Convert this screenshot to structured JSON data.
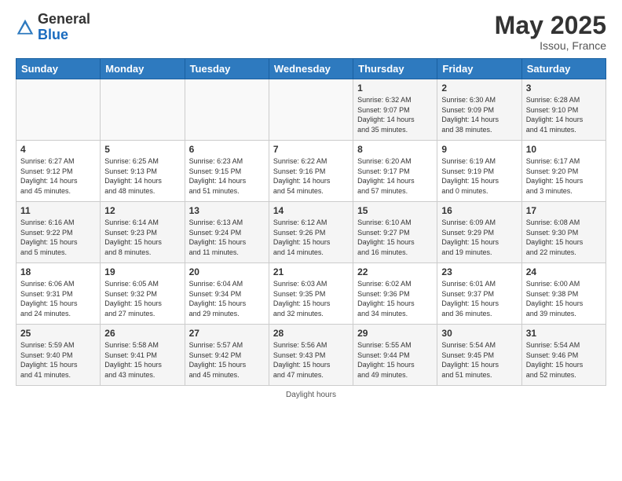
{
  "header": {
    "logo_general": "General",
    "logo_blue": "Blue",
    "month_title": "May 2025",
    "location": "Issou, France"
  },
  "footer": {
    "daylight_label": "Daylight hours"
  },
  "days_of_week": [
    "Sunday",
    "Monday",
    "Tuesday",
    "Wednesday",
    "Thursday",
    "Friday",
    "Saturday"
  ],
  "weeks": [
    {
      "days": [
        {
          "num": "",
          "info": ""
        },
        {
          "num": "",
          "info": ""
        },
        {
          "num": "",
          "info": ""
        },
        {
          "num": "",
          "info": ""
        },
        {
          "num": "1",
          "info": "Sunrise: 6:32 AM\nSunset: 9:07 PM\nDaylight: 14 hours\nand 35 minutes."
        },
        {
          "num": "2",
          "info": "Sunrise: 6:30 AM\nSunset: 9:09 PM\nDaylight: 14 hours\nand 38 minutes."
        },
        {
          "num": "3",
          "info": "Sunrise: 6:28 AM\nSunset: 9:10 PM\nDaylight: 14 hours\nand 41 minutes."
        }
      ]
    },
    {
      "days": [
        {
          "num": "4",
          "info": "Sunrise: 6:27 AM\nSunset: 9:12 PM\nDaylight: 14 hours\nand 45 minutes."
        },
        {
          "num": "5",
          "info": "Sunrise: 6:25 AM\nSunset: 9:13 PM\nDaylight: 14 hours\nand 48 minutes."
        },
        {
          "num": "6",
          "info": "Sunrise: 6:23 AM\nSunset: 9:15 PM\nDaylight: 14 hours\nand 51 minutes."
        },
        {
          "num": "7",
          "info": "Sunrise: 6:22 AM\nSunset: 9:16 PM\nDaylight: 14 hours\nand 54 minutes."
        },
        {
          "num": "8",
          "info": "Sunrise: 6:20 AM\nSunset: 9:17 PM\nDaylight: 14 hours\nand 57 minutes."
        },
        {
          "num": "9",
          "info": "Sunrise: 6:19 AM\nSunset: 9:19 PM\nDaylight: 15 hours\nand 0 minutes."
        },
        {
          "num": "10",
          "info": "Sunrise: 6:17 AM\nSunset: 9:20 PM\nDaylight: 15 hours\nand 3 minutes."
        }
      ]
    },
    {
      "days": [
        {
          "num": "11",
          "info": "Sunrise: 6:16 AM\nSunset: 9:22 PM\nDaylight: 15 hours\nand 5 minutes."
        },
        {
          "num": "12",
          "info": "Sunrise: 6:14 AM\nSunset: 9:23 PM\nDaylight: 15 hours\nand 8 minutes."
        },
        {
          "num": "13",
          "info": "Sunrise: 6:13 AM\nSunset: 9:24 PM\nDaylight: 15 hours\nand 11 minutes."
        },
        {
          "num": "14",
          "info": "Sunrise: 6:12 AM\nSunset: 9:26 PM\nDaylight: 15 hours\nand 14 minutes."
        },
        {
          "num": "15",
          "info": "Sunrise: 6:10 AM\nSunset: 9:27 PM\nDaylight: 15 hours\nand 16 minutes."
        },
        {
          "num": "16",
          "info": "Sunrise: 6:09 AM\nSunset: 9:29 PM\nDaylight: 15 hours\nand 19 minutes."
        },
        {
          "num": "17",
          "info": "Sunrise: 6:08 AM\nSunset: 9:30 PM\nDaylight: 15 hours\nand 22 minutes."
        }
      ]
    },
    {
      "days": [
        {
          "num": "18",
          "info": "Sunrise: 6:06 AM\nSunset: 9:31 PM\nDaylight: 15 hours\nand 24 minutes."
        },
        {
          "num": "19",
          "info": "Sunrise: 6:05 AM\nSunset: 9:32 PM\nDaylight: 15 hours\nand 27 minutes."
        },
        {
          "num": "20",
          "info": "Sunrise: 6:04 AM\nSunset: 9:34 PM\nDaylight: 15 hours\nand 29 minutes."
        },
        {
          "num": "21",
          "info": "Sunrise: 6:03 AM\nSunset: 9:35 PM\nDaylight: 15 hours\nand 32 minutes."
        },
        {
          "num": "22",
          "info": "Sunrise: 6:02 AM\nSunset: 9:36 PM\nDaylight: 15 hours\nand 34 minutes."
        },
        {
          "num": "23",
          "info": "Sunrise: 6:01 AM\nSunset: 9:37 PM\nDaylight: 15 hours\nand 36 minutes."
        },
        {
          "num": "24",
          "info": "Sunrise: 6:00 AM\nSunset: 9:38 PM\nDaylight: 15 hours\nand 39 minutes."
        }
      ]
    },
    {
      "days": [
        {
          "num": "25",
          "info": "Sunrise: 5:59 AM\nSunset: 9:40 PM\nDaylight: 15 hours\nand 41 minutes."
        },
        {
          "num": "26",
          "info": "Sunrise: 5:58 AM\nSunset: 9:41 PM\nDaylight: 15 hours\nand 43 minutes."
        },
        {
          "num": "27",
          "info": "Sunrise: 5:57 AM\nSunset: 9:42 PM\nDaylight: 15 hours\nand 45 minutes."
        },
        {
          "num": "28",
          "info": "Sunrise: 5:56 AM\nSunset: 9:43 PM\nDaylight: 15 hours\nand 47 minutes."
        },
        {
          "num": "29",
          "info": "Sunrise: 5:55 AM\nSunset: 9:44 PM\nDaylight: 15 hours\nand 49 minutes."
        },
        {
          "num": "30",
          "info": "Sunrise: 5:54 AM\nSunset: 9:45 PM\nDaylight: 15 hours\nand 51 minutes."
        },
        {
          "num": "31",
          "info": "Sunrise: 5:54 AM\nSunset: 9:46 PM\nDaylight: 15 hours\nand 52 minutes."
        }
      ]
    }
  ]
}
